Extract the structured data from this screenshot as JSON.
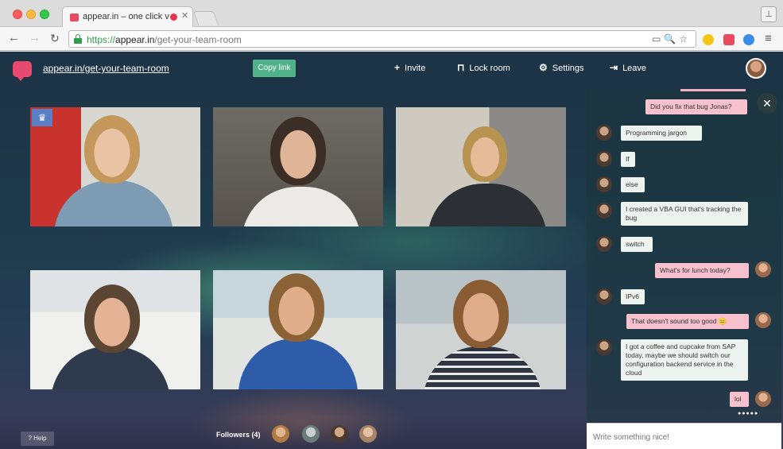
{
  "browser": {
    "tab_title": "appear.in – one click v",
    "url_protocol": "https://",
    "url_host": "appear.in",
    "url_path": "/get-your-team-room"
  },
  "topbar": {
    "room_name": "appear.in/get-your-team-room",
    "copy_label": "Copy link",
    "invite_label": "Invite",
    "lock_label": "Lock room",
    "settings_label": "Settings",
    "leave_label": "Leave"
  },
  "chat": {
    "messages": [
      {
        "from": "me",
        "text": "Did you fix that bug Jonas?"
      },
      {
        "from": "other",
        "text": "Programming jargon"
      },
      {
        "from": "other",
        "text": "If"
      },
      {
        "from": "other",
        "text": "else"
      },
      {
        "from": "other",
        "text": "I created a VBA GUI that's tracking the bug"
      },
      {
        "from": "other",
        "text": "switch"
      },
      {
        "from": "me",
        "text": "What's for lunch today?"
      },
      {
        "from": "other",
        "text": "IPv6"
      },
      {
        "from": "me",
        "text": "That doesn't sound too good 😐"
      },
      {
        "from": "other",
        "text": "I got a coffee and cupcake from SAP today, maybe we should switch our configuration backend service in the cloud"
      },
      {
        "from": "me",
        "text": "lol"
      }
    ],
    "composer_placeholder": "Write something nice!"
  },
  "bottom": {
    "help_label": "? Help",
    "followers_label": "Followers (4)"
  },
  "colors": {
    "accent_pink": "#e84a6f",
    "copy_green": "#4fb28a",
    "my_bubble": "#f6c1cd",
    "other_bubble": "#edf3ee"
  }
}
